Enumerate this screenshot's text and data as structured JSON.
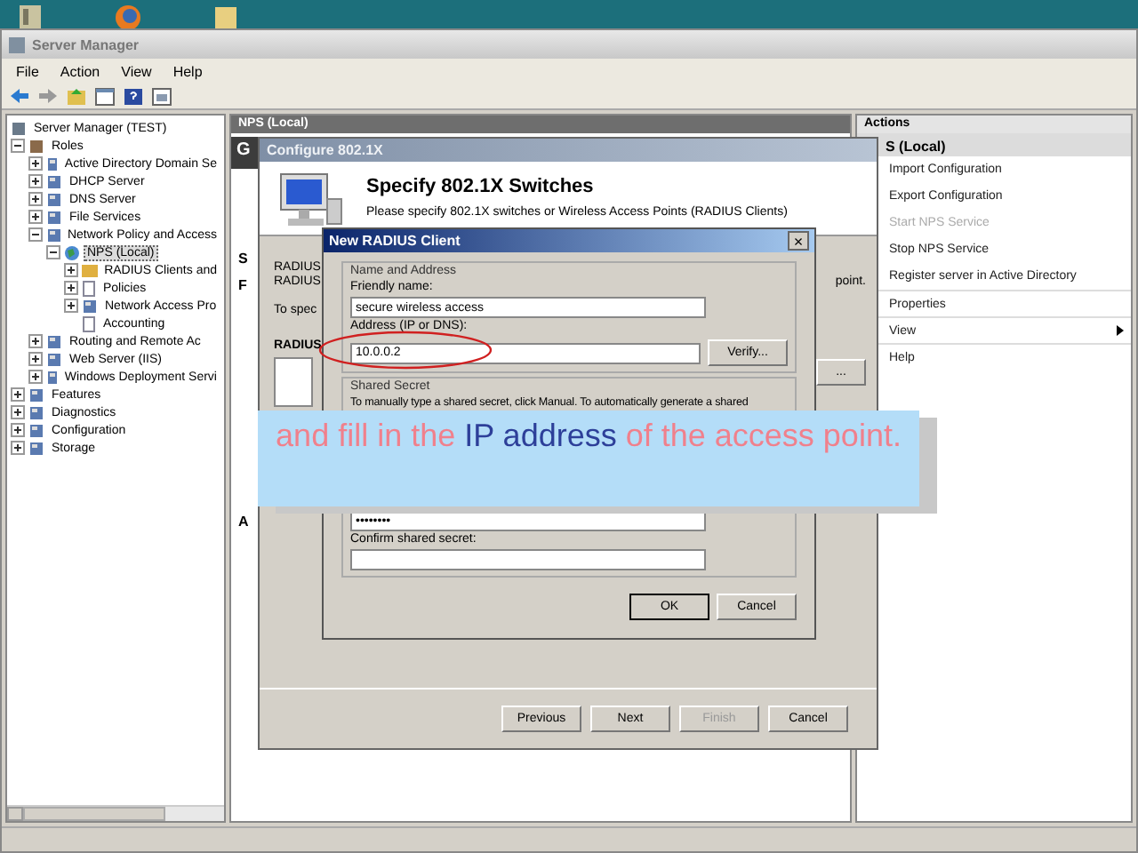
{
  "window": {
    "title": "Server Manager"
  },
  "menu": [
    "File",
    "Action",
    "View",
    "Help"
  ],
  "tree": [
    {
      "label": "Server Manager (TEST)",
      "kind": "server",
      "selected": false,
      "children": [
        {
          "label": "Roles",
          "kind": "roles",
          "expanded": true,
          "selected": false,
          "children": [
            {
              "label": "Active Directory Domain Se",
              "kind": "node",
              "expanded": false,
              "selected": false
            },
            {
              "label": "DHCP Server",
              "kind": "node",
              "expanded": false,
              "selected": false
            },
            {
              "label": "DNS Server",
              "kind": "node",
              "expanded": false,
              "selected": false
            },
            {
              "label": "File Services",
              "kind": "node",
              "expanded": false,
              "selected": false
            },
            {
              "label": "Network Policy and Access",
              "kind": "node",
              "expanded": true,
              "selected": false,
              "children": [
                {
                  "label": "NPS (Local)",
                  "kind": "globe",
                  "expanded": true,
                  "selected": true,
                  "children": [
                    {
                      "label": "RADIUS Clients and",
                      "kind": "folder",
                      "expanded": false,
                      "selected": false
                    },
                    {
                      "label": "Policies",
                      "kind": "doc",
                      "expanded": false,
                      "selected": false
                    },
                    {
                      "label": "Network Access Pro",
                      "kind": "node",
                      "expanded": false,
                      "selected": false
                    },
                    {
                      "label": "Accounting",
                      "kind": "doc",
                      "selected": false
                    }
                  ]
                }
              ]
            },
            {
              "label": "Routing and Remote Ac",
              "kind": "node",
              "expanded": false,
              "selected": false
            },
            {
              "label": "Web Server (IIS)",
              "kind": "node",
              "expanded": false,
              "selected": false
            },
            {
              "label": "Windows Deployment Servi",
              "kind": "node",
              "expanded": false,
              "selected": false
            }
          ]
        },
        {
          "label": "Features",
          "kind": "node",
          "expanded": false,
          "selected": false
        },
        {
          "label": "Diagnostics",
          "kind": "node",
          "expanded": false,
          "selected": false
        },
        {
          "label": "Configuration",
          "kind": "node",
          "expanded": false,
          "selected": false
        },
        {
          "label": "Storage",
          "kind": "node",
          "expanded": false,
          "selected": false
        }
      ]
    }
  ],
  "middle_pane": {
    "header": "NPS (Local)",
    "banner": "G",
    "tab": "S",
    "section": "F",
    "bottom_tab": "A"
  },
  "actions": {
    "header": "Actions",
    "section": "S (Local)",
    "items": [
      {
        "label": "Import Configuration",
        "disabled": false,
        "kind": "plain"
      },
      {
        "label": "Export Configuration",
        "disabled": false,
        "kind": "plain"
      },
      {
        "label": "Start NPS Service",
        "disabled": true,
        "kind": "plain"
      },
      {
        "label": "Stop NPS Service",
        "disabled": false,
        "kind": "plain"
      },
      {
        "label": "Register server in Active Directory",
        "disabled": false,
        "kind": "plain"
      },
      {
        "label": "Properties",
        "disabled": false,
        "kind": "separated"
      },
      {
        "label": "View",
        "disabled": false,
        "kind": "submenu"
      },
      {
        "label": "Help",
        "disabled": false,
        "kind": "separated"
      }
    ]
  },
  "wizard": {
    "title": "Configure 802.1X",
    "heading": "Specify 802.1X Switches",
    "subheading": "Please specify 802.1X switches or Wireless Access Points (RADIUS Clients)",
    "intro_lines": [
      "RADIUS",
      "RADIUS"
    ],
    "instruction": "To spec",
    "list_label": "RADIUS",
    "right_text": "point.",
    "side_button": "...",
    "buttons": [
      {
        "label": "Previous",
        "disabled": false
      },
      {
        "label": "Next",
        "disabled": false
      },
      {
        "label": "Finish",
        "disabled": true
      },
      {
        "label": "Cancel",
        "disabled": false
      }
    ]
  },
  "dialog": {
    "title": "New RADIUS Client",
    "close": "×",
    "group_name": "Name and Address",
    "friendly_label": "Friendly name:",
    "friendly_value": "secure wireless access",
    "address_label": "Address (IP or DNS):",
    "address_value": "10.0.0.2",
    "verify": "Verify...",
    "group_secret": "Shared Secret",
    "secret_help": "To manually type a shared secret, click Manual. To automatically generate a shared",
    "secret_value": "••••••••",
    "confirm_label": "Confirm shared secret:",
    "ok": "OK",
    "cancel": "Cancel"
  },
  "caption": [
    {
      "text": "and fill in the ",
      "kind": "plain"
    },
    {
      "text": "IP address",
      "kind": "highlight"
    },
    {
      "text": " of the access point.",
      "kind": "plain"
    }
  ]
}
